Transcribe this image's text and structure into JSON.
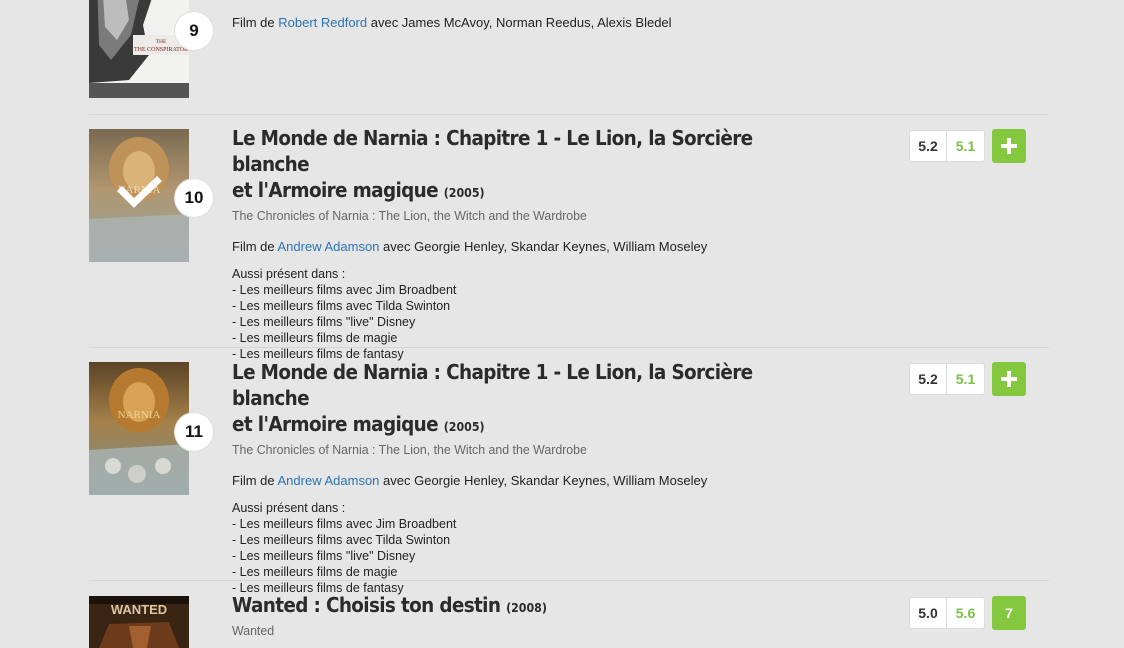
{
  "entries": [
    {
      "rank": "9",
      "credits": {
        "prefix": "Film de ",
        "director": "Robert Redford",
        "cast": " avec James McAvoy, Norman Reedus, Alexis Bledel"
      }
    },
    {
      "rank": "10",
      "title_line1": "Le Monde de Narnia : Chapitre 1 - Le Lion, la Sorcière blanche",
      "title_line2": "et l'Armoire magique",
      "year": "(2005)",
      "original_title": "The Chronicles of Narnia : The Lion, the Witch and the Wardrobe",
      "credits": {
        "prefix": "Film de ",
        "director": "Andrew Adamson",
        "cast": " avec Georgie Henley, Skandar Keynes, William Moseley"
      },
      "also_label": "Aussi présent dans :",
      "also": [
        "- Les meilleurs films avec Jim Broadbent",
        "- Les meilleurs films avec Tilda Swinton",
        "- Les meilleurs films \"live\" Disney",
        "- Les meilleurs films de magie",
        "- Les meilleurs films de fantasy"
      ],
      "press_score": "5.2",
      "user_score": "5.1",
      "seen": true
    },
    {
      "rank": "11",
      "title_line1": "Le Monde de Narnia : Chapitre 1 - Le Lion, la Sorcière blanche",
      "title_line2": "et l'Armoire magique",
      "year": "(2005)",
      "original_title": "The Chronicles of Narnia : The Lion, the Witch and the Wardrobe",
      "credits": {
        "prefix": "Film de ",
        "director": "Andrew Adamson",
        "cast": " avec Georgie Henley, Skandar Keynes, William Moseley"
      },
      "also_label": "Aussi présent dans :",
      "also": [
        "- Les meilleurs films avec Jim Broadbent",
        "- Les meilleurs films avec Tilda Swinton",
        "- Les meilleurs films \"live\" Disney",
        "- Les meilleurs films de magie",
        "- Les meilleurs films de fantasy"
      ],
      "press_score": "5.2",
      "user_score": "5.1",
      "seen": false
    },
    {
      "title_line1": "Wanted : Choisis ton destin",
      "year": "(2008)",
      "original_title": "Wanted",
      "press_score": "5.0",
      "user_score": "5.6",
      "user_rating": "7"
    }
  ],
  "posters": {
    "conspirator_text": "THE CONSPIRATOR",
    "narnia_text": "NARNIA",
    "wanted_text": "WANTED"
  },
  "colors": {
    "link": "#2b74b6",
    "accent_green": "#83c83f",
    "user_score_green": "#7ac143",
    "background": "#e6e6e6"
  },
  "icons": {
    "add": "plus-icon",
    "seen": "checkmark-icon"
  }
}
